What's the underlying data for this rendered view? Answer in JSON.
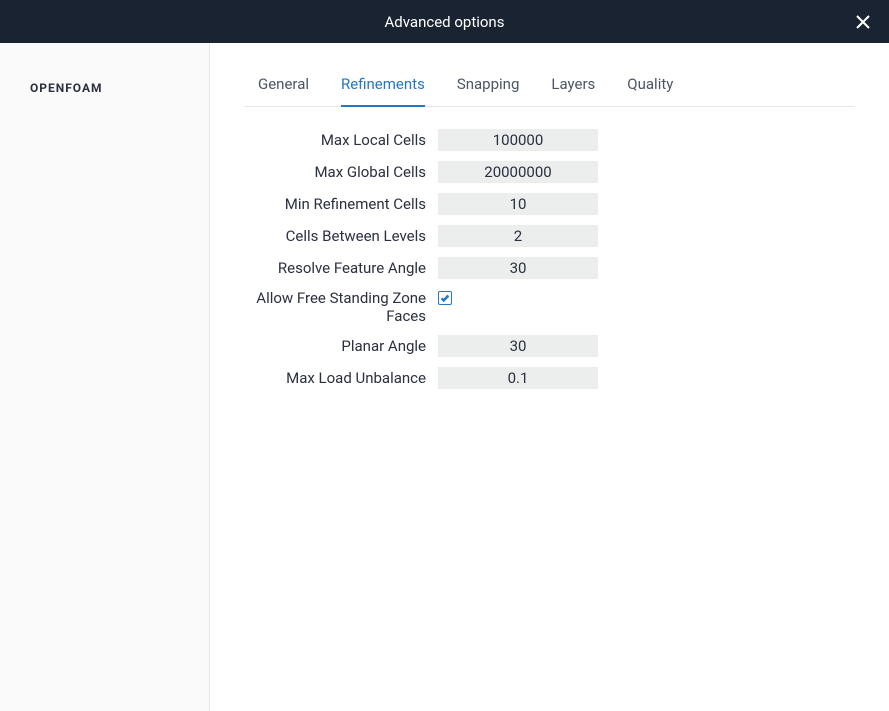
{
  "header": {
    "title": "Advanced options"
  },
  "sidebar": {
    "items": [
      {
        "label": "OPENFOAM"
      }
    ]
  },
  "tabs": [
    {
      "label": "General",
      "active": false
    },
    {
      "label": "Refinements",
      "active": true
    },
    {
      "label": "Snapping",
      "active": false
    },
    {
      "label": "Layers",
      "active": false
    },
    {
      "label": "Quality",
      "active": false
    }
  ],
  "form": {
    "max_local_cells": {
      "label": "Max Local Cells",
      "value": "100000"
    },
    "max_global_cells": {
      "label": "Max Global Cells",
      "value": "20000000"
    },
    "min_refinement_cells": {
      "label": "Min Refinement Cells",
      "value": "10"
    },
    "cells_between_levels": {
      "label": "Cells Between Levels",
      "value": "2"
    },
    "resolve_feature_angle": {
      "label": "Resolve Feature Angle",
      "value": "30"
    },
    "allow_free_standing_zone_faces": {
      "label": "Allow Free Standing Zone Faces",
      "checked": true
    },
    "planar_angle": {
      "label": "Planar Angle",
      "value": "30"
    },
    "max_load_unbalance": {
      "label": "Max Load Unbalance",
      "value": "0.1"
    }
  }
}
